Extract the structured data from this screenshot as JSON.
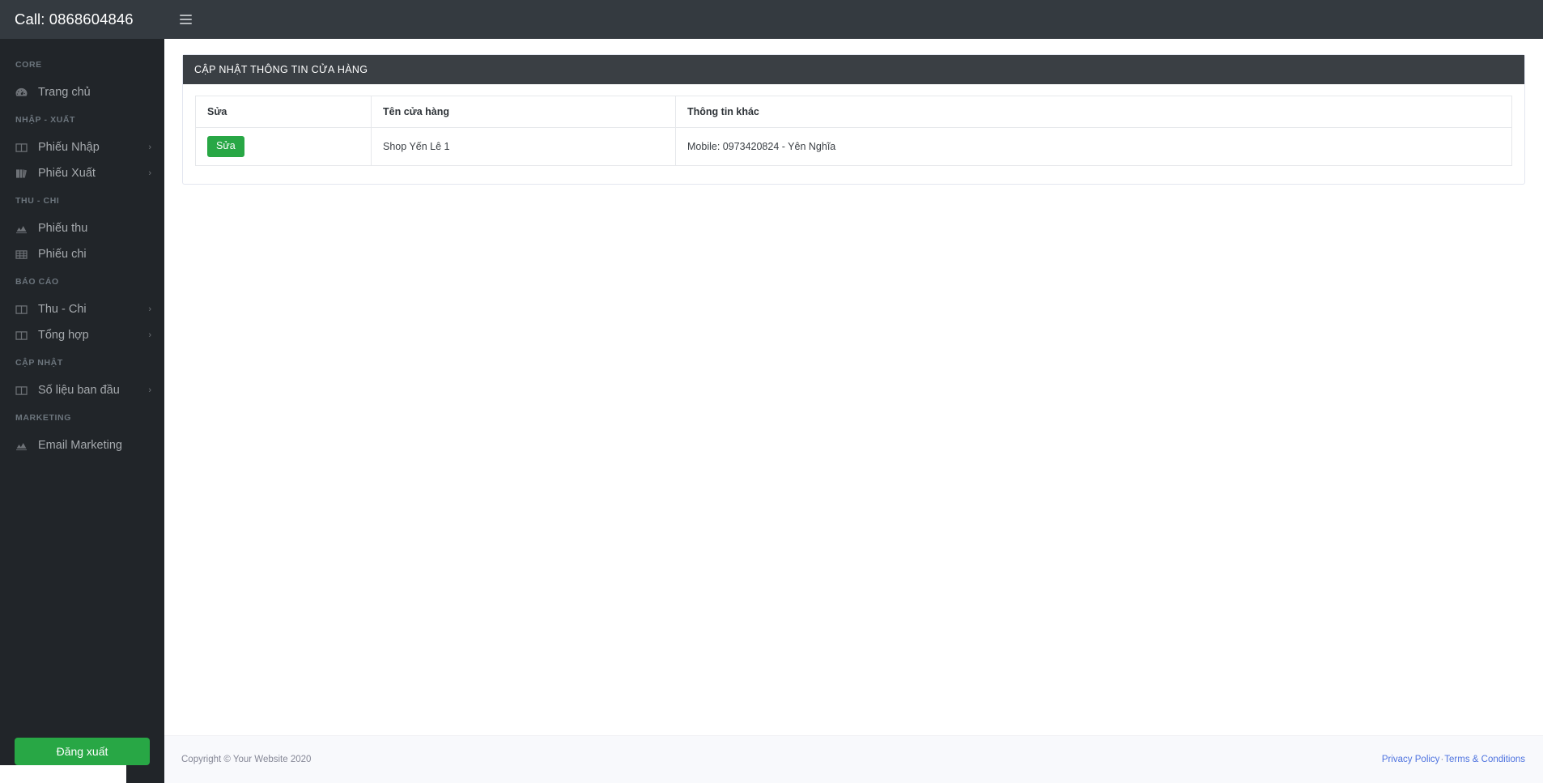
{
  "sidebar": {
    "brand": "Call: 0868604846",
    "logout_label": "Đăng xuất",
    "sections": [
      {
        "heading": "CORE",
        "items": [
          {
            "label": "Trang chủ",
            "icon": "dashboard-icon",
            "caret": ""
          }
        ]
      },
      {
        "heading": "NHẬP - XUẤT",
        "items": [
          {
            "label": "Phiếu Nhập",
            "icon": "columns-icon",
            "caret": "›"
          },
          {
            "label": "Phiếu Xuất",
            "icon": "book-icon",
            "caret": "›"
          }
        ]
      },
      {
        "heading": "THU - CHI",
        "items": [
          {
            "label": "Phiếu thu",
            "icon": "chart-area-icon",
            "caret": ""
          },
          {
            "label": "Phiếu chi",
            "icon": "table-icon",
            "caret": ""
          }
        ]
      },
      {
        "heading": "BÁO CÁO",
        "items": [
          {
            "label": "Thu - Chi",
            "icon": "columns-icon",
            "caret": "›"
          },
          {
            "label": "Tổng hợp",
            "icon": "columns-icon",
            "caret": "›"
          }
        ]
      },
      {
        "heading": "CẬP NHẬT",
        "items": [
          {
            "label": "Số liệu ban đầu",
            "icon": "columns-icon",
            "caret": "›"
          }
        ]
      },
      {
        "heading": "MARKETING",
        "items": [
          {
            "label": "Email Marketing",
            "icon": "chart-area-icon",
            "caret": ""
          }
        ]
      }
    ]
  },
  "topbar": {
    "toggle_icon": "hamburger-icon"
  },
  "card": {
    "title": "CẬP NHẬT THÔNG TIN CỬA HÀNG"
  },
  "table": {
    "columns": [
      "Sửa",
      "Tên cửa hàng",
      "Thông tin khác"
    ],
    "rows": [
      {
        "action_label": "Sửa",
        "store_name": "Shop Yến Lê 1",
        "other_info": "Mobile: 0973420824 - Yên Nghĩa"
      }
    ]
  },
  "footer": {
    "copyright": "Copyright © Your Website 2020",
    "privacy_label": "Privacy Policy",
    "separator": "·",
    "terms_label": "Terms & Conditions"
  },
  "colors": {
    "sidebar_bg": "#212529",
    "topbar_bg": "#343a40",
    "card_header_bg": "#3a3f44",
    "accent_green": "#28a745",
    "link_blue": "#4e73df",
    "footer_bg": "#f8f9fc"
  }
}
